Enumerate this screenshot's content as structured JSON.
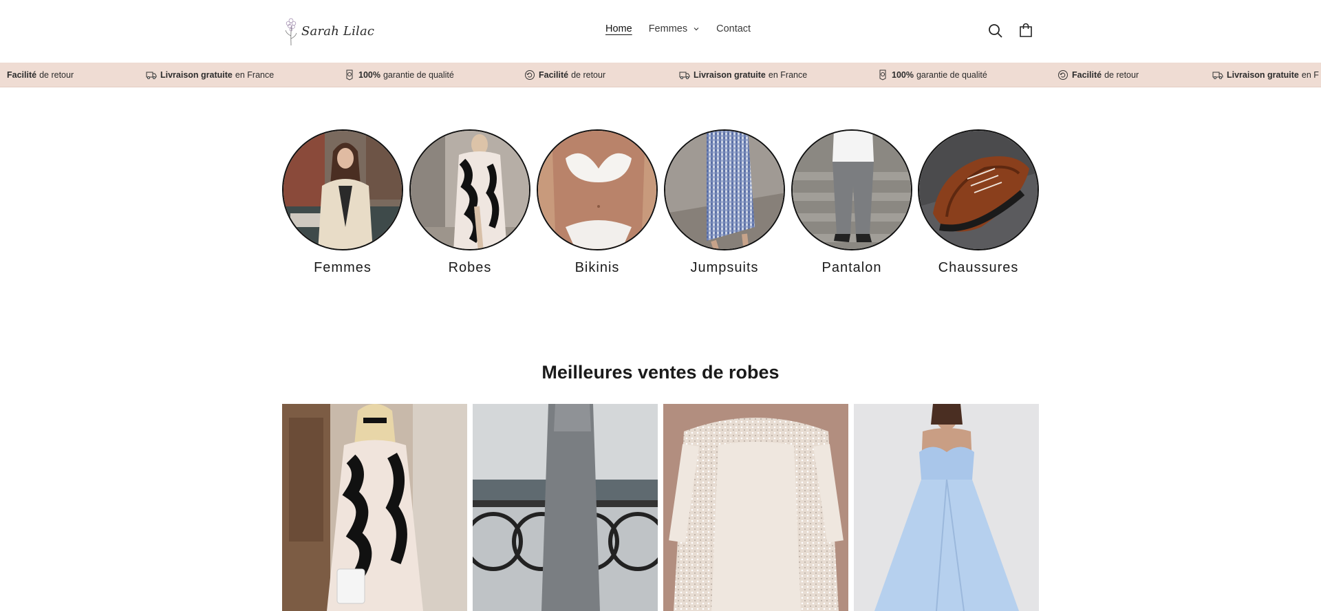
{
  "header": {
    "brand": "Sarah Lilac",
    "nav": [
      {
        "label": "Home"
      },
      {
        "label": "Femmes"
      },
      {
        "label": "Contact"
      }
    ]
  },
  "strip": {
    "items": [
      {
        "bold": "Facilité",
        "rest": "de retour",
        "icon": "return-icon"
      },
      {
        "bold": "Livraison gratuite",
        "rest": "en France",
        "icon": "truck-icon"
      },
      {
        "bold": "100%",
        "rest": "garantie de qualité",
        "icon": "quality-badge-icon"
      },
      {
        "bold": "Facilité",
        "rest": "de retour",
        "icon": "return-icon"
      },
      {
        "bold": "Livraison gratuite",
        "rest": "en France",
        "icon": "truck-icon"
      },
      {
        "bold": "100%",
        "rest": "garantie de qualité",
        "icon": "quality-badge-icon"
      },
      {
        "bold": "Facilité",
        "rest": "de retour",
        "icon": "return-icon"
      },
      {
        "bold": "Livraison gratuite",
        "rest": "en F",
        "icon": "truck-icon"
      }
    ]
  },
  "categories": [
    {
      "label": "Femmes"
    },
    {
      "label": "Robes"
    },
    {
      "label": "Bikinis"
    },
    {
      "label": "Jumpsuits"
    },
    {
      "label": "Pantalon"
    },
    {
      "label": "Chaussures"
    }
  ],
  "bestsellers": {
    "title": "Meilleures ventes de robes"
  },
  "colors": {
    "strip_bg": "#efdcd3",
    "text": "#121212",
    "circle_border": "#111111"
  }
}
